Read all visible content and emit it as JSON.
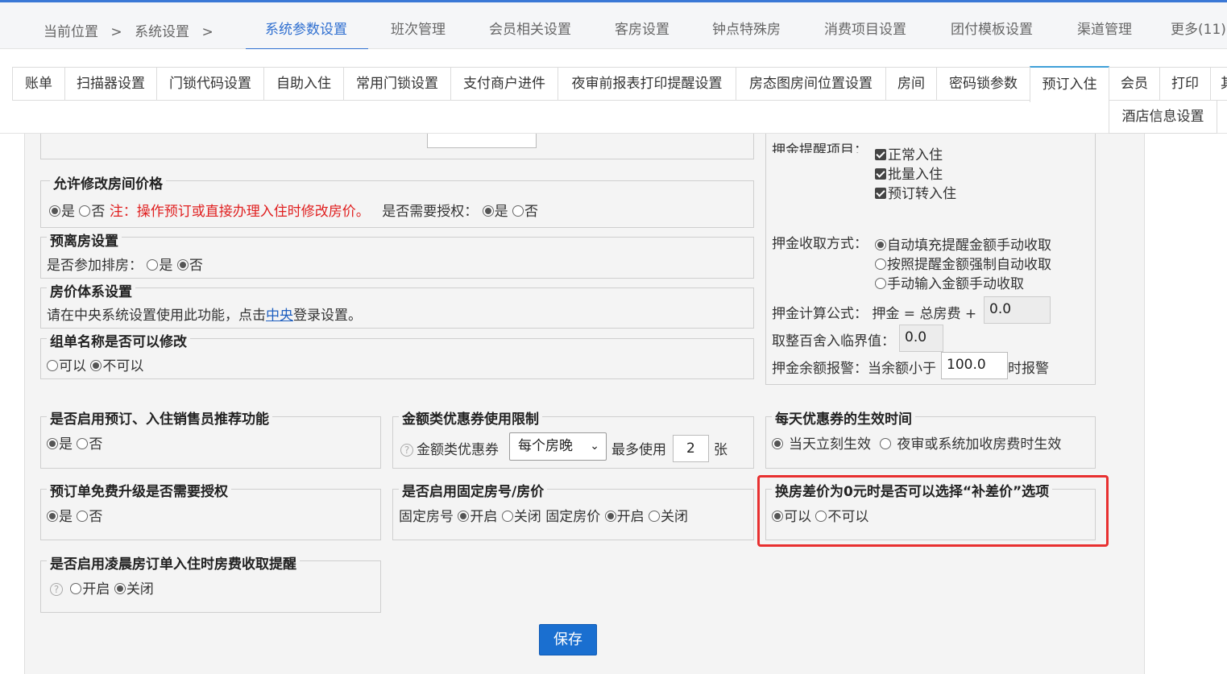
{
  "breadcrumb": {
    "current": "当前位置",
    "sep1": ">",
    "section": "系统设置",
    "sep2": ">"
  },
  "top_tabs": [
    "系统参数设置",
    "班次管理",
    "会员相关设置",
    "客房设置",
    "钟点特殊房",
    "消费项目设置",
    "团付模板设置",
    "渠道管理",
    "更多(11)"
  ],
  "sub_tabs": [
    "账单",
    "扫描器设置",
    "门锁代码设置",
    "自助入住",
    "常用门锁设置",
    "支付商户进件",
    "夜审前报表打印提醒设置",
    "房态图房间位置设置",
    "房间",
    "密码锁参数",
    "预订入住",
    "会员",
    "打印",
    "其",
    "酒店信息设置"
  ],
  "modify_price": {
    "legend": "允许修改房间价格",
    "yes": "是",
    "no": "否",
    "note": "注：操作预订或直接办理入住时修改房价。",
    "auth_label": "是否需要授权：",
    "auth_yes": "是",
    "auth_no": "否"
  },
  "pre_checkout": {
    "legend": "预离房设置",
    "label": "是否参加排房：",
    "yes": "是",
    "no": "否"
  },
  "price_system": {
    "legend": "房价体系设置",
    "text1": "请在中央系统设置使用此功能，点击",
    "link": "中央",
    "text2": "登录设置。"
  },
  "group_name": {
    "legend": "组单名称是否可以修改",
    "can": "可以",
    "cannot": "不可以"
  },
  "deposit": {
    "remind_label": "押金提醒项目：",
    "remind_items": [
      "正常入住",
      "批量入住",
      "预订转入住"
    ],
    "collect_label": "押金收取方式：",
    "collect_options": [
      "自动填充提醒金额手动收取",
      "按照提醒金额强制自动收取",
      "手动输入金额手动收取"
    ],
    "formula_label": "押金计算公式：",
    "formula_text": "押金 = 总房费 +",
    "formula_value": "0.0",
    "rounding_label": "取整百舍入临界值：",
    "rounding_value": "0.0",
    "alarm_label": "押金余额报警：当余额小于",
    "alarm_value": "100.0",
    "alarm_suffix": "时报警"
  },
  "salesman": {
    "legend": "是否启用预订、入住销售员推荐功能",
    "yes": "是",
    "no": "否"
  },
  "coupon_limit": {
    "legend": "金额类优惠券使用限制",
    "label": "金额类优惠券",
    "select": "每个房晚",
    "most": "最多使用",
    "count": "2",
    "unit": "张"
  },
  "coupon_time": {
    "legend": "每天优惠券的生效时间",
    "opt1": "当天立刻生效",
    "opt2": "夜审或系统加收房费时生效"
  },
  "upgrade_auth": {
    "legend": "预订单免费升级是否需要授权",
    "yes": "是",
    "no": "否"
  },
  "fixed_room": {
    "legend": "是否启用固定房号/房价",
    "room_label": "固定房号",
    "room_on": "开启",
    "room_off": "关闭",
    "price_label": "固定房价",
    "price_on": "开启",
    "price_off": "关闭"
  },
  "diff_price": {
    "legend": "换房差价为0元时是否可以选择“补差价”选项",
    "can": "可以",
    "cannot": "不可以"
  },
  "early_morning": {
    "legend": "是否启用凌晨房订单入住时房费收取提醒",
    "on": "开启",
    "off": "关闭"
  },
  "save_label": "保存",
  "colors": {
    "accent": "#2f6fd0",
    "highlight": "#e83030",
    "button": "#1a6fd0"
  }
}
